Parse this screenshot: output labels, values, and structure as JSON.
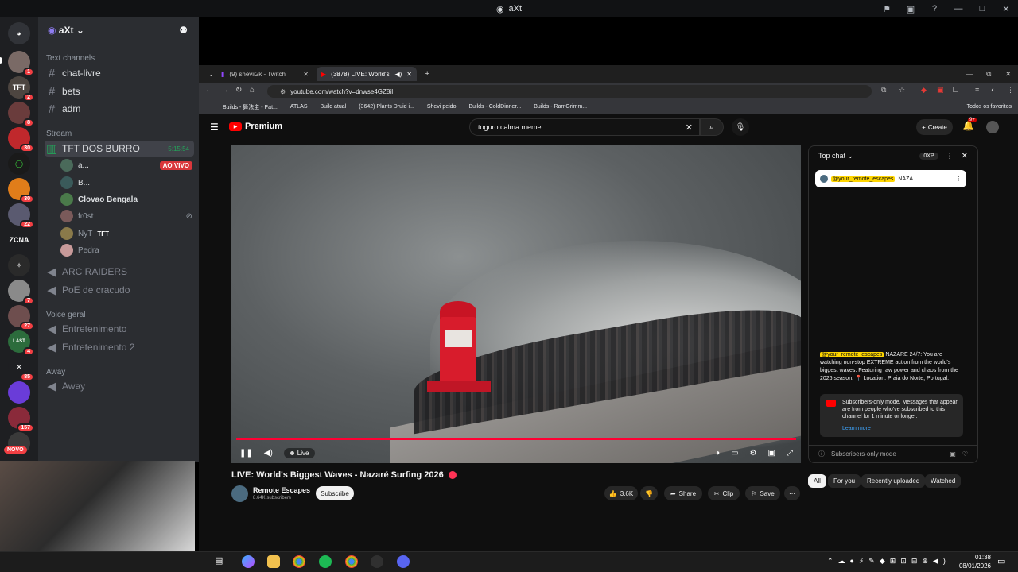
{
  "window": {
    "title": "aXt"
  },
  "discord": {
    "server_name": "aXt",
    "rail": [
      {
        "badge": "1"
      },
      {
        "badge": "2"
      },
      {
        "badge": "8"
      },
      {
        "badge": "30"
      },
      {
        "badge": ""
      },
      {
        "badge": "30"
      },
      {
        "badge": "22"
      },
      {
        "label": "ZCNA"
      },
      {
        "badge": ""
      },
      {
        "badge": "7"
      },
      {
        "badge": "27"
      },
      {
        "badge": "4"
      },
      {
        "badge": "85"
      },
      {
        "badge": ""
      },
      {
        "badge": "157"
      },
      {
        "badge": "NOVO"
      }
    ],
    "categories": {
      "text": "Text channels",
      "stream": "Stream",
      "voice": "Voice geral",
      "away": "Away"
    },
    "text_channels": [
      "chat-livre",
      "bets",
      "adm"
    ],
    "stream_channel": {
      "name": "TFT DOS BURRO",
      "timer": "5:15:54"
    },
    "stream_users": [
      {
        "name": "a...",
        "badge": "AO VIVO"
      },
      {
        "name": "B..."
      },
      {
        "name": "Clovao Bengala"
      },
      {
        "name": "fr0st"
      },
      {
        "name": "NyT",
        "tag": "TFT"
      },
      {
        "name": "Pedra"
      }
    ],
    "stream_extra": [
      "ARC RAIDERS",
      "PoE de cracudo"
    ],
    "voice_channels": [
      "Entretenimento",
      "Entretenimento 2"
    ],
    "away_channels": [
      "Away"
    ]
  },
  "browser": {
    "tabs": [
      {
        "label": "(9) shevii2k - Twitch"
      },
      {
        "label": "(3878) LIVE: World's Biggest"
      }
    ],
    "url": "youtube.com/watch?v=dnwse4GZ8iI",
    "bookmarks": [
      "Builds - 舞法主 - Pat...",
      "ATLAS",
      "Build atual",
      "(3642) Plants Druid i...",
      "Shevi peido",
      "Builds - ColdDinner...",
      "Builds - RamGrimm..."
    ],
    "bookmarks_right": "Todos os favoritos"
  },
  "youtube": {
    "logo": "Premium",
    "search_value": "toguro calma meme",
    "create_label": "Create",
    "notif_count": "9+",
    "video": {
      "live_label": "Live",
      "title": "LIVE: World's Biggest Waves - Nazaré Surfing 2026",
      "channel": "Remote Escapes",
      "subscribers": "8.64K subscribers",
      "subscribe_label": "Subscribe",
      "likes": "3.6K",
      "share_label": "Share",
      "clip_label": "Clip",
      "save_label": "Save"
    },
    "chat": {
      "header": "Top chat",
      "points": "0XP",
      "pinned_user": "@your_remote_escapes",
      "pinned_text": "NAZA...",
      "message_user": "@your_remote_escapes",
      "message_text": "NAZARE 24/7: You are watching non-stop EXTREME action from the world's biggest waves. Featuring raw power and chaos from the 2026 season. 📍 Location: Praia do Norte, Portugal.",
      "submode_text": "Subscribers-only mode. Messages that appear are from people who've subscribed to this channel for 1 minute or longer.",
      "learn_more": "Learn more",
      "footer": "Subscribers-only mode"
    },
    "chips": [
      "All",
      "For you",
      "Recently uploaded",
      "Watched"
    ]
  },
  "taskbar": {
    "time": "01:38",
    "date": "08/01/2026"
  }
}
